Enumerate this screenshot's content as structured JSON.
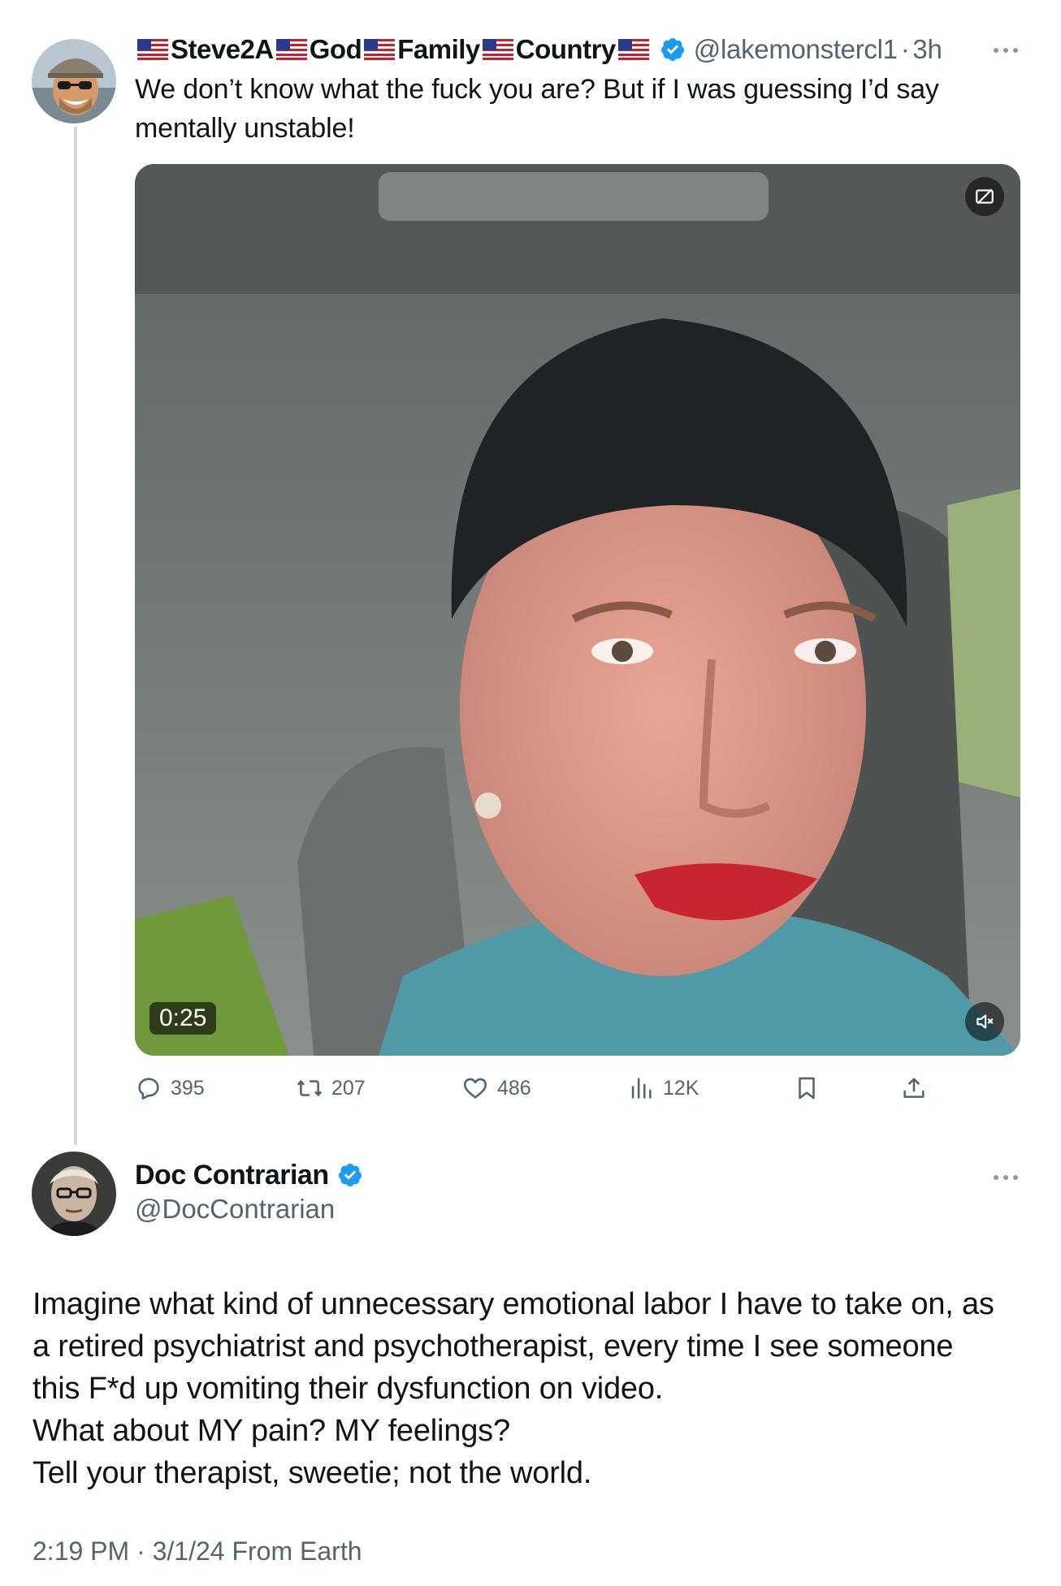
{
  "tweet1": {
    "display_name_parts": [
      "Steve2A",
      "God",
      "Family",
      "Country"
    ],
    "handle": "@lakemonstercl1",
    "separator": "·",
    "time": "3h",
    "text": "We don’t know what the fuck you are? But if I was guessing I’d say mentally unstable!",
    "media": {
      "duration": "0:25"
    },
    "actions": {
      "replies": "395",
      "reposts": "207",
      "likes": "486",
      "views": "12K"
    }
  },
  "tweet2": {
    "display_name": "Doc Contrarian",
    "handle": "@DocContrarian",
    "text_lines": [
      "Imagine what kind of unnecessary emotional labor I have to take on, as",
      "a retired psychiatrist and psychotherapist, every time I see someone",
      "this F*d up vomiting their dysfunction on video.",
      "What about MY pain? MY feelings?",
      "Tell your therapist, sweetie; not the world."
    ],
    "timestamp": "2:19 PM · 3/1/24 From Earth"
  },
  "colors": {
    "verified_blue": "#1d9bf0",
    "secondary_text": "#536471",
    "primary_text": "#0f1419",
    "thread_line": "#cfd9de"
  },
  "icons": [
    "flag-us-icon",
    "verified-badge-icon",
    "more-icon",
    "reply-icon",
    "repost-icon",
    "like-icon",
    "views-icon",
    "bookmark-icon",
    "share-icon",
    "captions-off-icon",
    "muted-icon"
  ]
}
